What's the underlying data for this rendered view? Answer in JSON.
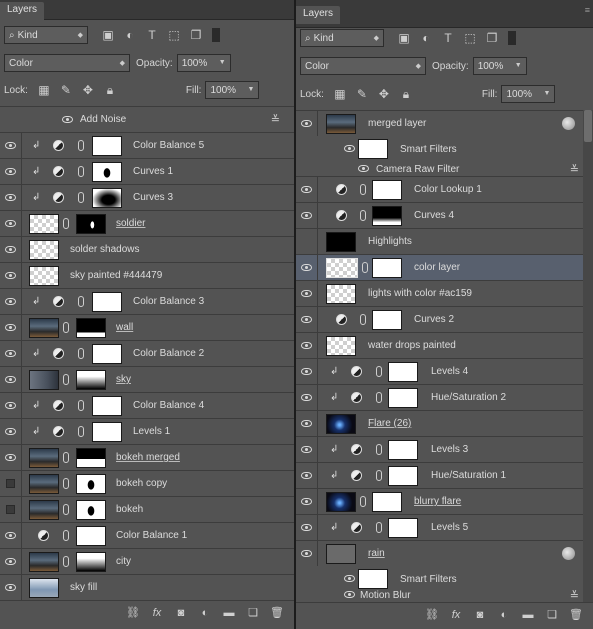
{
  "left": {
    "tab": "Layers",
    "filter": "Kind",
    "blend_mode": "Color",
    "opacity_label": "Opacity:",
    "opacity": "100%",
    "lock_label": "Lock:",
    "fill_label": "Fill:",
    "fill": "100%",
    "group_header": "Add Noise",
    "layers": [
      {
        "name": "Color Balance 5"
      },
      {
        "name": "Curves 1"
      },
      {
        "name": "Curves 3"
      },
      {
        "name": "soldier"
      },
      {
        "name": "solder shadows"
      },
      {
        "name": "sky painted #444479"
      },
      {
        "name": "Color Balance 3"
      },
      {
        "name": "wall"
      },
      {
        "name": "Color Balance 2"
      },
      {
        "name": "sky"
      },
      {
        "name": "Color Balance 4"
      },
      {
        "name": "Levels 1"
      },
      {
        "name": "bokeh merged"
      },
      {
        "name": "bokeh copy"
      },
      {
        "name": "bokeh"
      },
      {
        "name": "Color Balance 1"
      },
      {
        "name": "city"
      },
      {
        "name": "sky fill"
      }
    ]
  },
  "right": {
    "tab": "Layers",
    "filter": "Kind",
    "blend_mode": "Color",
    "opacity_label": "Opacity:",
    "opacity": "100%",
    "lock_label": "Lock:",
    "fill_label": "Fill:",
    "fill": "100%",
    "layers": [
      {
        "name": "merged layer"
      },
      {
        "name": "Smart Filters"
      },
      {
        "name": "Camera Raw Filter"
      },
      {
        "name": "Color Lookup 1"
      },
      {
        "name": "Curves 4"
      },
      {
        "name": "Highlights"
      },
      {
        "name": "color layer"
      },
      {
        "name": "lights with color #ac159"
      },
      {
        "name": "Curves 2"
      },
      {
        "name": "water drops painted"
      },
      {
        "name": "Levels 4"
      },
      {
        "name": "Hue/Saturation 2"
      },
      {
        "name": "Flare (26)"
      },
      {
        "name": "Levels 3"
      },
      {
        "name": "Hue/Saturation 1"
      },
      {
        "name": "blurry flare"
      },
      {
        "name": "Levels 5"
      },
      {
        "name": "rain"
      },
      {
        "name": "Smart Filters"
      },
      {
        "name": "Motion Blur"
      }
    ]
  },
  "icons": {
    "footer": [
      "link-icon",
      "fx-icon",
      "mask-icon",
      "adjustment-icon",
      "folder-icon",
      "new-layer-icon",
      "trash-icon"
    ]
  }
}
